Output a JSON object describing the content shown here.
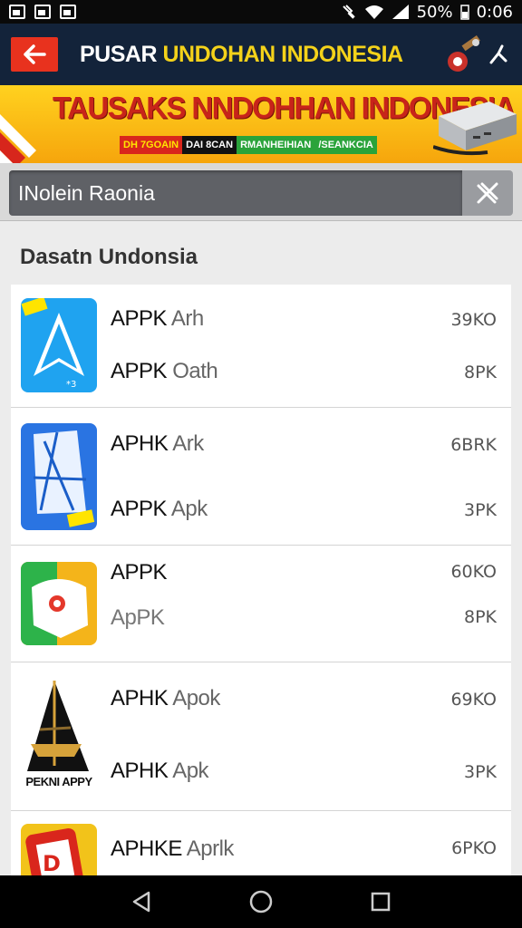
{
  "status_bar": {
    "battery": "50%",
    "time": "0:06"
  },
  "app_bar": {
    "title_start": "PUSAR ",
    "title_accent": "UNDOHAN INDONESIA"
  },
  "banner": {
    "headline": "TAUSAKS NNDOHHAN INDONESIA",
    "tags": [
      "DH 7GOAIN",
      "DAI 8CAN",
      "RMANHEIHIAN",
      "/SEANKCIA"
    ]
  },
  "search": {
    "value": "INolein Raonia",
    "placeholder": "INolein Raonia"
  },
  "section": {
    "title": "Dasatn Undonsia"
  },
  "apps": [
    {
      "line1_main": "APPK",
      "line1_sub": "Arh",
      "line2_main": "APPK",
      "line2_sub": "Oath",
      "size1": "39KO",
      "size2": "8PK",
      "icon": "navigation-arrow-icon"
    },
    {
      "line1_main": "APHK",
      "line1_sub": "Ark",
      "line2_main": "APPK",
      "line2_sub": "Apk",
      "size1": "6BRK",
      "size2": "3PK",
      "icon": "folded-paper-icon"
    },
    {
      "line1_main": "APPK",
      "line1_sub": "",
      "line2_main": "",
      "line2_sub": "ApPK",
      "size1": "60KO",
      "size2": "8PK",
      "icon": "chat-face-icon"
    },
    {
      "line1_main": "APHK",
      "line1_sub": "Apok",
      "line2_main": "APHK",
      "line2_sub": "Apk",
      "size1": "69KO",
      "size2": "3PK",
      "icon": "pyramid-app-icon",
      "icon_label": "PEKNI APPY"
    },
    {
      "line1_main": "APHKE",
      "line1_sub": "Aprlk",
      "line2_main": "",
      "line2_sub": "",
      "size1": "6PKO",
      "size2": "",
      "icon": "red-card-icon"
    }
  ],
  "colors": {
    "app_bar": "#13233a",
    "back_button": "#e8321e",
    "title_accent": "#f4d21a",
    "banner": "#ffd21f",
    "headline": "#c8241a"
  }
}
